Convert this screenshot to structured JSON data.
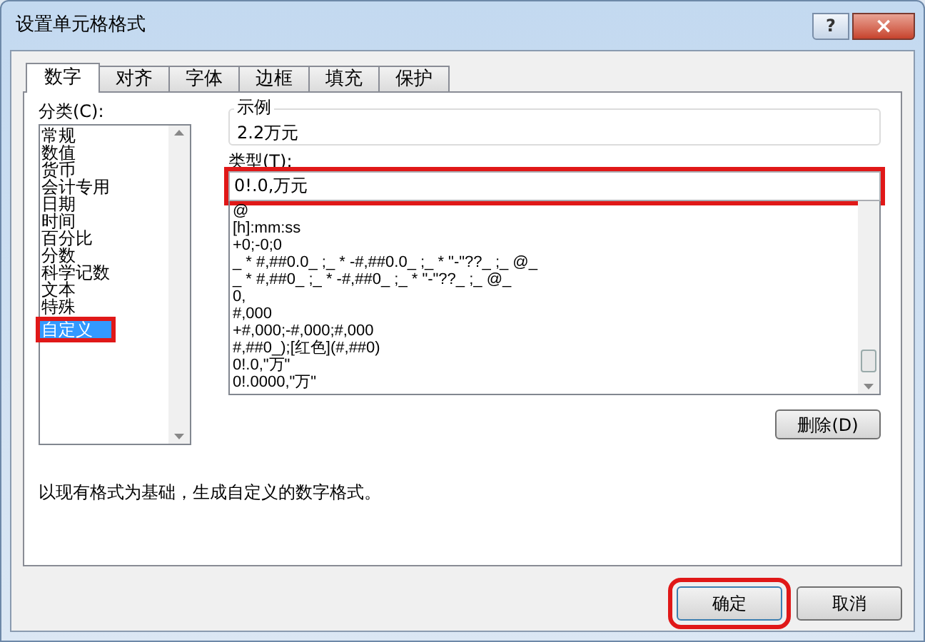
{
  "window": {
    "title": "设置单元格格式",
    "help": "?",
    "close": "×"
  },
  "tabs": [
    {
      "label": "数字",
      "selected": true
    },
    {
      "label": "对齐",
      "selected": false
    },
    {
      "label": "字体",
      "selected": false
    },
    {
      "label": "边框",
      "selected": false
    },
    {
      "label": "填充",
      "selected": false
    },
    {
      "label": "保护",
      "selected": false
    }
  ],
  "category": {
    "label": "分类(C):",
    "items": [
      {
        "label": "常规",
        "selected": false,
        "highlighted": false
      },
      {
        "label": "数值",
        "selected": false,
        "highlighted": false
      },
      {
        "label": "货币",
        "selected": false,
        "highlighted": false
      },
      {
        "label": "会计专用",
        "selected": false,
        "highlighted": false
      },
      {
        "label": "日期",
        "selected": false,
        "highlighted": false
      },
      {
        "label": "时间",
        "selected": false,
        "highlighted": false
      },
      {
        "label": "百分比",
        "selected": false,
        "highlighted": false
      },
      {
        "label": "分数",
        "selected": false,
        "highlighted": false
      },
      {
        "label": "科学记数",
        "selected": false,
        "highlighted": false
      },
      {
        "label": "文本",
        "selected": false,
        "highlighted": false
      },
      {
        "label": "特殊",
        "selected": false,
        "highlighted": false
      },
      {
        "label": "自定义",
        "selected": true,
        "highlighted": true
      }
    ]
  },
  "sample": {
    "label": "示例",
    "value": "2.2万元"
  },
  "type": {
    "label": "类型(T):",
    "value": "0!.0,万元",
    "highlighted": true,
    "formats": [
      "@",
      "[h]:mm:ss",
      "+0;-0;0",
      "_ * #,##0.0_ ;_ * -#,##0.0_ ;_ * \"-\"??_ ;_ @_",
      "_ * #,##0_ ;_ * -#,##0_ ;_ * \"-\"??_ ;_ @_",
      "0,",
      "#,000",
      "+#,000;-#,000;#,000",
      "#,##0_);[红色](#,##0)",
      "0!.0,\"万\"",
      "0!.0000,\"万\""
    ]
  },
  "delete_button": "删除(D)",
  "description": "以现有格式为基础，生成自定义的数字格式。",
  "buttons": [
    {
      "label": "确定",
      "highlighted": true
    },
    {
      "label": "取消",
      "highlighted": false
    }
  ]
}
